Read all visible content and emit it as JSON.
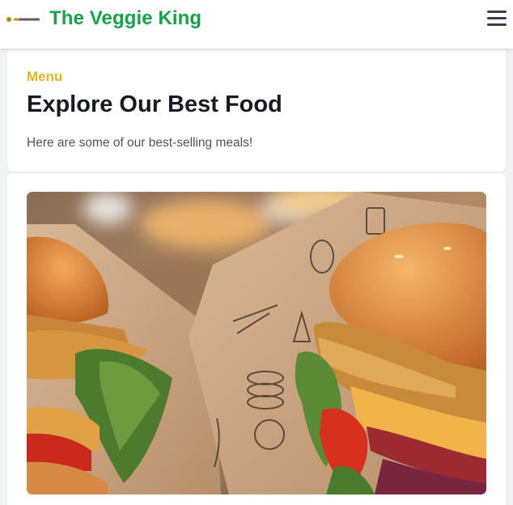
{
  "header": {
    "brand": "The Veggie King",
    "logo_text": "THE VEGGIE KING",
    "logo_icon": "veggie-king-logo",
    "menu_icon": "hamburger-menu-icon"
  },
  "intro": {
    "eyebrow": "Menu",
    "heading": "Explore Our Best Food",
    "subtext": "Here are some of our best-selling meals!"
  },
  "featured": {
    "image_alt": "Two veggie burgers wrapped in kraft paper"
  },
  "colors": {
    "brand_green": "#16a34a",
    "eyebrow_yellow": "#e2b51a",
    "heading_dark": "#171a22",
    "body_gray": "#4b5563"
  }
}
